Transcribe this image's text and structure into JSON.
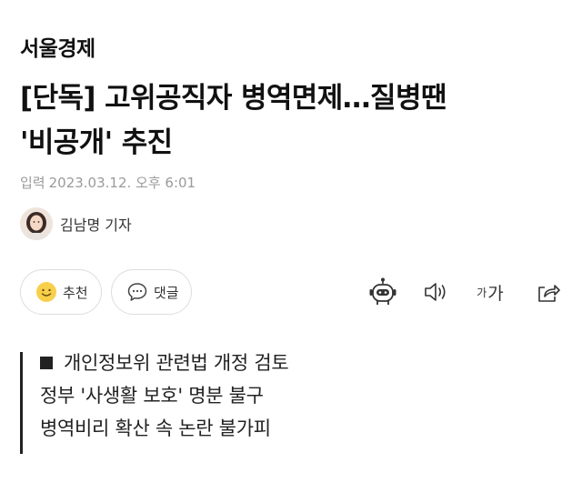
{
  "press": {
    "name": "서울경제"
  },
  "article": {
    "headline_line1": "[단독] 고위공직자 병역면제…질병땐",
    "headline_line2": "'비공개' 추진",
    "date_label": "입력",
    "date_value": "2023.03.12. 오후 6:01",
    "reporter": "김남명 기자"
  },
  "actions": {
    "recommend_label": "추천",
    "comment_label": "댓글",
    "font_small": "가",
    "font_large": "가"
  },
  "summary": {
    "lines": [
      "개인정보위 관련법 개정 검토",
      "정부 '사생활 보호' 명분 불구",
      "병역비리 확산 속 논란 불가피"
    ]
  },
  "icons": {
    "recommend": "smile-icon",
    "comment": "speech-bubble-icon",
    "robot": "robot-icon",
    "audio": "speaker-icon",
    "font": "font-size-icon",
    "share": "share-icon"
  }
}
